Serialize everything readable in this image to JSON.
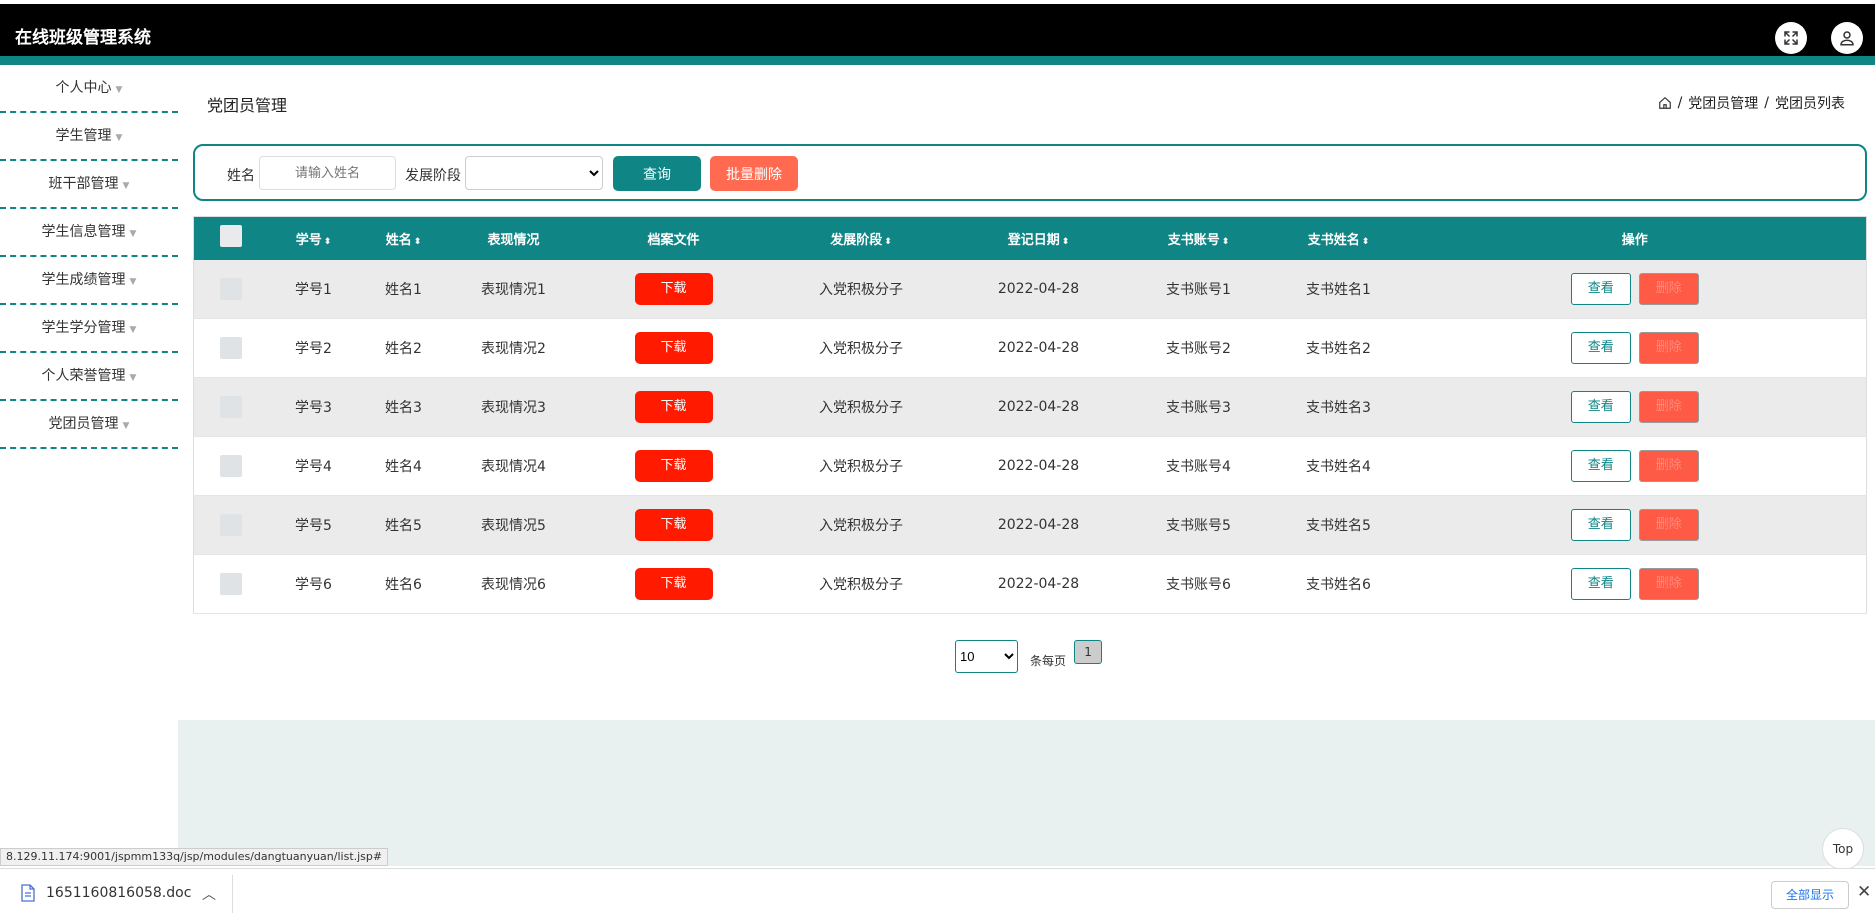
{
  "app": {
    "title": "在线班级管理系统"
  },
  "header_icons": [
    "fullscreen-icon",
    "user-icon"
  ],
  "sidebar": {
    "items": [
      {
        "label": "个人中心"
      },
      {
        "label": "学生管理"
      },
      {
        "label": "班干部管理"
      },
      {
        "label": "学生信息管理"
      },
      {
        "label": "学生成绩管理"
      },
      {
        "label": "学生学分管理"
      },
      {
        "label": "个人荣誉管理"
      },
      {
        "label": "党团员管理"
      }
    ]
  },
  "page": {
    "title": "党团员管理",
    "breadcrumb": [
      "党团员管理",
      "党团员列表"
    ]
  },
  "search": {
    "name_label": "姓名",
    "name_placeholder": "请输入姓名",
    "stage_label": "发展阶段",
    "query_btn": "查询",
    "batch_delete_btn": "批量删除"
  },
  "table": {
    "headers": {
      "xuehao": "学号",
      "xingming": "姓名",
      "biaoxian": "表现情况",
      "dangan": "档案文件",
      "jieduan": "发展阶段",
      "riqi": "登记日期",
      "zhanghao": "支书账号",
      "zhishu": "支书姓名",
      "caozuo": "操作"
    },
    "download_label": "下载",
    "view_label": "查看",
    "delete_label": "删除",
    "rows": [
      {
        "xuehao": "学号1",
        "xingming": "姓名1",
        "biaoxian": "表现情况1",
        "jieduan": "入党积极分子",
        "riqi": "2022-04-28",
        "zhanghao": "支书账号1",
        "zhishu": "支书姓名1"
      },
      {
        "xuehao": "学号2",
        "xingming": "姓名2",
        "biaoxian": "表现情况2",
        "jieduan": "入党积极分子",
        "riqi": "2022-04-28",
        "zhanghao": "支书账号2",
        "zhishu": "支书姓名2"
      },
      {
        "xuehao": "学号3",
        "xingming": "姓名3",
        "biaoxian": "表现情况3",
        "jieduan": "入党积极分子",
        "riqi": "2022-04-28",
        "zhanghao": "支书账号3",
        "zhishu": "支书姓名3"
      },
      {
        "xuehao": "学号4",
        "xingming": "姓名4",
        "biaoxian": "表现情况4",
        "jieduan": "入党积极分子",
        "riqi": "2022-04-28",
        "zhanghao": "支书账号4",
        "zhishu": "支书姓名4"
      },
      {
        "xuehao": "学号5",
        "xingming": "姓名5",
        "biaoxian": "表现情况5",
        "jieduan": "入党积极分子",
        "riqi": "2022-04-28",
        "zhanghao": "支书账号5",
        "zhishu": "支书姓名5"
      },
      {
        "xuehao": "学号6",
        "xingming": "姓名6",
        "biaoxian": "表现情况6",
        "jieduan": "入党积极分子",
        "riqi": "2022-04-28",
        "zhanghao": "支书账号6",
        "zhishu": "支书姓名6"
      }
    ]
  },
  "pager": {
    "page_size": "10",
    "per_page_label": "条每页",
    "current_page": "1"
  },
  "status_url": "8.129.11.174:9001/jspmm133q/jsp/modules/dangtuanyuan/list.jsp#",
  "top_button": "Top",
  "download_bar": {
    "filename": "1651160816058.doc",
    "show_all": "全部显示"
  }
}
